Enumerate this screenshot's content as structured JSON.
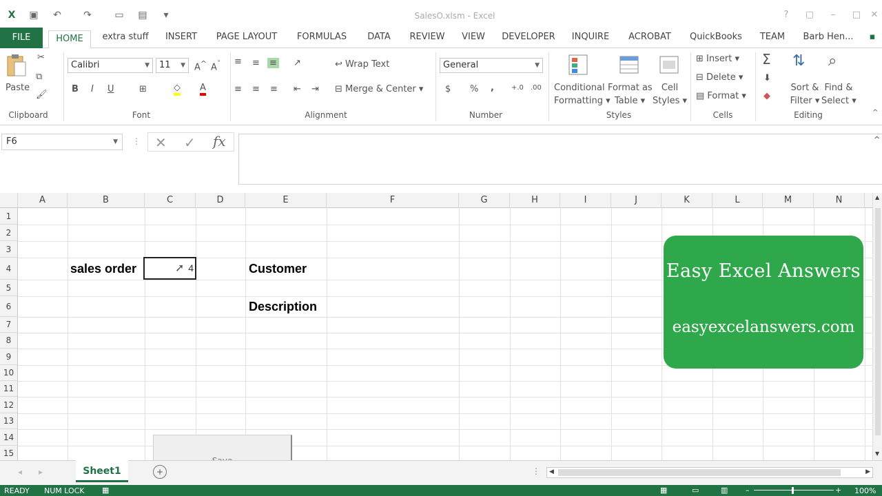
{
  "window": {
    "title": "SalesO.xlsm - Excel"
  },
  "tabs": [
    "FILE",
    "HOME",
    "extra stuff",
    "INSERT",
    "PAGE LAYOUT",
    "FORMULAS",
    "DATA",
    "REVIEW",
    "VIEW",
    "DEVELOPER",
    "INQUIRE",
    "ACROBAT",
    "QuickBooks",
    "TEAM"
  ],
  "user": "Barb Hen...",
  "ribbon": {
    "clipboard": {
      "paste": "Paste",
      "label": "Clipboard"
    },
    "font": {
      "name": "Calibri",
      "size": "11",
      "label": "Font",
      "bold": "B",
      "italic": "I",
      "underline": "U"
    },
    "alignment": {
      "wrap": "Wrap Text",
      "merge": "Merge & Center",
      "label": "Alignment"
    },
    "number": {
      "format": "General",
      "currency": "$",
      "percent": "%",
      "comma": ",",
      "label": "Number"
    },
    "styles": {
      "conditional1": "Conditional",
      "conditional2": "Formatting",
      "table1": "Format as",
      "table2": "Table",
      "cell1": "Cell",
      "cell2": "Styles",
      "label": "Styles"
    },
    "cells": {
      "insert": "Insert",
      "delete": "Delete",
      "format": "Format",
      "label": "Cells"
    },
    "editing": {
      "sort1": "Sort &",
      "sort2": "Filter",
      "find1": "Find &",
      "find2": "Select",
      "label": "Editing"
    }
  },
  "formula_bar": {
    "name_box": "F6",
    "fx": "fx",
    "content": ""
  },
  "grid": {
    "columns": [
      "A",
      "B",
      "C",
      "D",
      "E",
      "F",
      "G",
      "H",
      "I",
      "J",
      "K",
      "L",
      "M",
      "N"
    ],
    "rows": [
      "1",
      "2",
      "3",
      "4",
      "5",
      "6",
      "7",
      "8",
      "9",
      "10",
      "11",
      "12",
      "13",
      "14",
      "15"
    ],
    "cells": {
      "B4": "sales order",
      "C4": "4",
      "E4": "Customer",
      "E6": "Description"
    }
  },
  "overlay": {
    "line1": "Easy Excel Answers",
    "line2": "easyexcelanswers.com"
  },
  "button": {
    "label": "Save"
  },
  "sheets": [
    "Sheet1"
  ],
  "status": {
    "ready": "READY",
    "numlock": "NUM LOCK",
    "zoom": "100%"
  },
  "colors": {
    "excel_green": "#217346",
    "badge_green": "#2ea84a"
  }
}
